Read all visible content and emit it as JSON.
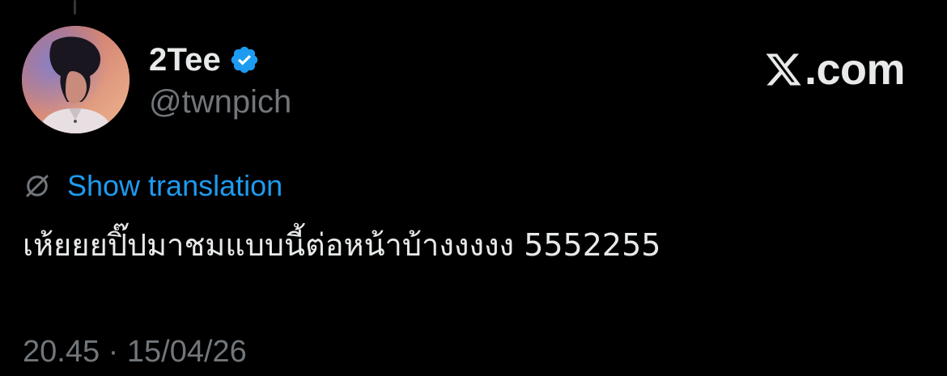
{
  "tweet": {
    "author": {
      "display_name": "2Tee",
      "handle": "@twnpich",
      "verified": true,
      "avatar_icon": "profile-photo"
    },
    "brand": {
      "logo_icon": "x-logo-icon",
      "text": ".com"
    },
    "translation": {
      "icon": "globe-translate-icon",
      "label": "Show translation"
    },
    "text": "เห้ยยยปิ๊ปมาชมแบบนี้ต่อหน้าบ้างงงงง 5552255",
    "timestamp": "20.45 · 15/04/26"
  },
  "colors": {
    "background": "#000000",
    "primary_text": "#e7e9ea",
    "secondary_text": "#71767b",
    "link": "#1d9bf0",
    "verified_badge": "#1d9bf0"
  }
}
